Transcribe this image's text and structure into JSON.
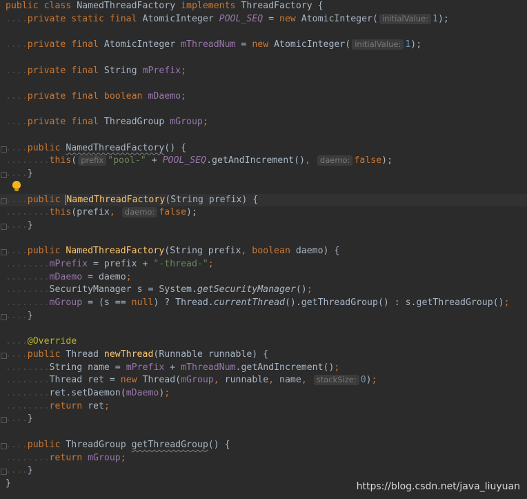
{
  "watermark": "https://blog.csdn.net/java_liuyuan",
  "colors": {
    "background": "#2b2b2b",
    "keyword": "#cc7832",
    "field": "#9876aa",
    "string": "#6a8759",
    "number": "#6897bb",
    "method_decl": "#ffc66d",
    "annotation": "#bbb529",
    "text": "#a9b7c6",
    "hint_bg": "#3b3b3b",
    "hint_text": "#787878",
    "caret_line": "#323232"
  },
  "icons": {
    "intention": "lightbulb-icon",
    "gutter": "fold-marker-icon"
  },
  "lines": [
    [
      [
        "kw",
        "public class "
      ],
      [
        "plain",
        "NamedThreadFactory "
      ],
      [
        "kw",
        "implements "
      ],
      [
        "plain",
        "ThreadFactory {"
      ]
    ],
    [
      [
        "ws",
        "...."
      ],
      [
        "kw",
        "private static final "
      ],
      [
        "plain",
        "AtomicInteger "
      ],
      [
        "sfld",
        "POOL_SEQ"
      ],
      [
        "plain",
        " = "
      ],
      [
        "kw",
        "new "
      ],
      [
        "plain",
        "AtomicInteger("
      ],
      [
        "hint",
        "initialValue:"
      ],
      [
        "num",
        "1"
      ],
      [
        "plain",
        ");"
      ]
    ],
    [],
    [
      [
        "ws",
        "...."
      ],
      [
        "kw",
        "private final "
      ],
      [
        "plain",
        "AtomicInteger "
      ],
      [
        "fld",
        "mThreadNum"
      ],
      [
        "plain",
        " = "
      ],
      [
        "kw",
        "new "
      ],
      [
        "plain",
        "AtomicInteger("
      ],
      [
        "hint",
        "initialValue:"
      ],
      [
        "num",
        "1"
      ],
      [
        "plain",
        ");"
      ]
    ],
    [],
    [
      [
        "ws",
        "...."
      ],
      [
        "kw",
        "private final "
      ],
      [
        "plain",
        "String "
      ],
      [
        "fld",
        "mPrefix"
      ],
      [
        "kw",
        ";"
      ]
    ],
    [],
    [
      [
        "ws",
        "...."
      ],
      [
        "kw",
        "private final boolean "
      ],
      [
        "fld",
        "mDaemo"
      ],
      [
        "kw",
        ";"
      ]
    ],
    [],
    [
      [
        "ws",
        "...."
      ],
      [
        "kw",
        "private final "
      ],
      [
        "plain",
        "ThreadGroup "
      ],
      [
        "fld",
        "mGroup"
      ],
      [
        "kw",
        ";"
      ]
    ],
    [],
    [
      [
        "ws",
        "...."
      ],
      [
        "kw",
        "public "
      ],
      [
        "squig",
        "NamedThreadFactory"
      ],
      [
        "plain",
        "() {"
      ]
    ],
    [
      [
        "ws",
        "........"
      ],
      [
        "kw",
        "this"
      ],
      [
        "plain",
        "("
      ],
      [
        "hint",
        "prefix"
      ],
      [
        "str",
        "\"pool-\""
      ],
      [
        "plain",
        " + "
      ],
      [
        "sfld",
        "POOL_SEQ"
      ],
      [
        "plain",
        ".getAndIncrement()"
      ],
      [
        "kw",
        ", "
      ],
      [
        "hint",
        "daemo:"
      ],
      [
        "kw",
        "false"
      ],
      [
        "plain",
        ");"
      ]
    ],
    [
      [
        "ws",
        "...."
      ],
      [
        "plain",
        "}"
      ]
    ],
    [],
    [
      [
        "ws",
        "...."
      ],
      [
        "kw",
        "public "
      ],
      [
        "caret",
        ""
      ],
      [
        "fn",
        "NamedThreadFactory"
      ],
      [
        "plain",
        "(String prefix) {"
      ]
    ],
    [
      [
        "ws",
        "........"
      ],
      [
        "kw",
        "this"
      ],
      [
        "plain",
        "(prefix"
      ],
      [
        "kw",
        ", "
      ],
      [
        "hint",
        "daemo:"
      ],
      [
        "kw",
        "false"
      ],
      [
        "plain",
        ");"
      ]
    ],
    [
      [
        "ws",
        "...."
      ],
      [
        "plain",
        "}"
      ]
    ],
    [],
    [
      [
        "ws",
        "...."
      ],
      [
        "kw",
        "public "
      ],
      [
        "fn",
        "NamedThreadFactory"
      ],
      [
        "plain",
        "(String prefix"
      ],
      [
        "kw",
        ", boolean "
      ],
      [
        "plain",
        "daemo) {"
      ]
    ],
    [
      [
        "ws",
        "........"
      ],
      [
        "fld",
        "mPrefix"
      ],
      [
        "plain",
        " = prefix + "
      ],
      [
        "str",
        "\"-thread-\""
      ],
      [
        "kw",
        ";"
      ]
    ],
    [
      [
        "ws",
        "........"
      ],
      [
        "fld",
        "mDaemo"
      ],
      [
        "plain",
        " = daemo"
      ],
      [
        "kw",
        ";"
      ]
    ],
    [
      [
        "ws",
        "........"
      ],
      [
        "plain",
        "SecurityManager s = System."
      ],
      [
        "smeth",
        "getSecurityManager"
      ],
      [
        "plain",
        "()"
      ],
      [
        "kw",
        ";"
      ]
    ],
    [
      [
        "ws",
        "........"
      ],
      [
        "fld",
        "mGroup"
      ],
      [
        "plain",
        " = (s == "
      ],
      [
        "kw",
        "null"
      ],
      [
        "plain",
        ") ? Thread."
      ],
      [
        "smeth",
        "currentThread"
      ],
      [
        "plain",
        "().getThreadGroup() : s.getThreadGroup()"
      ],
      [
        "kw",
        ";"
      ]
    ],
    [
      [
        "ws",
        "...."
      ],
      [
        "plain",
        "}"
      ]
    ],
    [],
    [
      [
        "ws",
        "...."
      ],
      [
        "ann",
        "@Override"
      ]
    ],
    [
      [
        "ws",
        "...."
      ],
      [
        "kw",
        "public "
      ],
      [
        "plain",
        "Thread "
      ],
      [
        "fn",
        "newThread"
      ],
      [
        "plain",
        "(Runnable runnable) {"
      ]
    ],
    [
      [
        "ws",
        "........"
      ],
      [
        "plain",
        "String name = "
      ],
      [
        "fld",
        "mPrefix"
      ],
      [
        "plain",
        " + "
      ],
      [
        "fld",
        "mThreadNum"
      ],
      [
        "plain",
        ".getAndIncrement()"
      ],
      [
        "kw",
        ";"
      ]
    ],
    [
      [
        "ws",
        "........"
      ],
      [
        "plain",
        "Thread ret = "
      ],
      [
        "kw",
        "new "
      ],
      [
        "plain",
        "Thread("
      ],
      [
        "fld",
        "mGroup"
      ],
      [
        "kw",
        ", "
      ],
      [
        "plain",
        "runnable"
      ],
      [
        "kw",
        ", "
      ],
      [
        "plain",
        "name"
      ],
      [
        "kw",
        ", "
      ],
      [
        "hint",
        "stackSize:"
      ],
      [
        "num",
        "0"
      ],
      [
        "plain",
        ")"
      ],
      [
        "kw",
        ";"
      ]
    ],
    [
      [
        "ws",
        "........"
      ],
      [
        "plain",
        "ret.setDaemon("
      ],
      [
        "fld",
        "mDaemo"
      ],
      [
        "plain",
        ")"
      ],
      [
        "kw",
        ";"
      ]
    ],
    [
      [
        "ws",
        "........"
      ],
      [
        "kw",
        "return "
      ],
      [
        "plain",
        "ret"
      ],
      [
        "kw",
        ";"
      ]
    ],
    [
      [
        "ws",
        "...."
      ],
      [
        "plain",
        "}"
      ]
    ],
    [],
    [
      [
        "ws",
        "...."
      ],
      [
        "kw",
        "public "
      ],
      [
        "plain",
        "ThreadGroup "
      ],
      [
        "squig",
        "getThreadGroup"
      ],
      [
        "plain",
        "() {"
      ]
    ],
    [
      [
        "ws",
        "........"
      ],
      [
        "kw",
        "return "
      ],
      [
        "fld",
        "mGroup"
      ],
      [
        "kw",
        ";"
      ]
    ],
    [
      [
        "ws",
        "...."
      ],
      [
        "plain",
        "}"
      ]
    ],
    [
      [
        "plain",
        "}"
      ]
    ]
  ]
}
